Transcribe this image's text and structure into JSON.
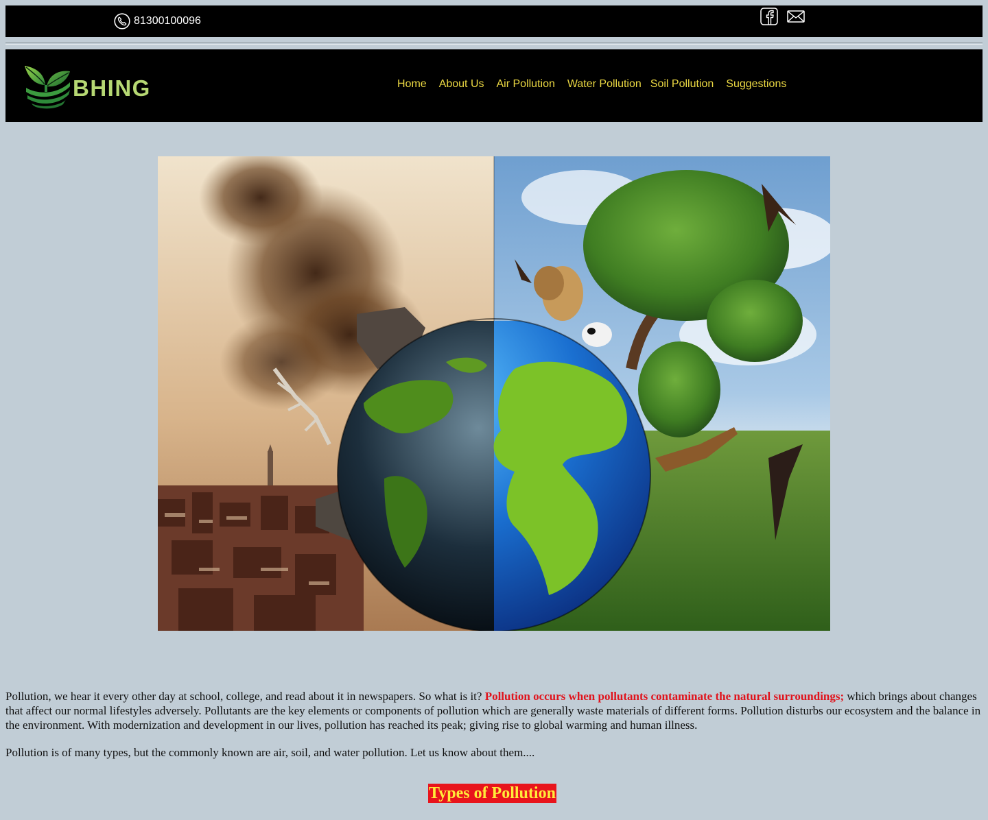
{
  "topbar": {
    "phone_icon": "phone-icon",
    "phone_number": "81300100096",
    "social_icons": [
      "facebook-icon",
      "mail-icon"
    ]
  },
  "header": {
    "logo_icon": "leaf-icon",
    "logo_text": "BHING",
    "nav": [
      {
        "label": "Home"
      },
      {
        "label": "About Us"
      },
      {
        "label": "Air Pollution"
      },
      {
        "label": "Water Pollution"
      },
      {
        "label": "Soil Pollution"
      },
      {
        "label": "Suggestions"
      }
    ]
  },
  "hero": {
    "image": "earth-half-polluted-half-green-illustration"
  },
  "content": {
    "intro_before": "Pollution, we hear it every other day at school, college, and read about it in newspapers. So what is it?",
    "intro_highlight": "Pollution occurs when pollutants contaminate the natural surroundings;",
    "intro_after": "which brings about changes that affect our normal lifestyles adversely. Pollutants are the key elements or components of pollution which are generally waste materials of different forms. Pollution disturbs our ecosystem and the balance in the environment. With modernization and development in our lives, pollution has reached its peak; giving rise to global warming and human illness.",
    "paragraph2": "Pollution is of many types, but the commonly known are air, soil, and water pollution. Let us know about them....",
    "types_heading": "Types of Pollution"
  },
  "colors": {
    "page_background": "#c1cdd6",
    "bar_background": "#000000",
    "nav_link": "#ecd943",
    "logo_text": "#b6d873",
    "highlight_text": "#e0131c",
    "heading_background": "#e8141c",
    "heading_text": "#ffec3a"
  }
}
